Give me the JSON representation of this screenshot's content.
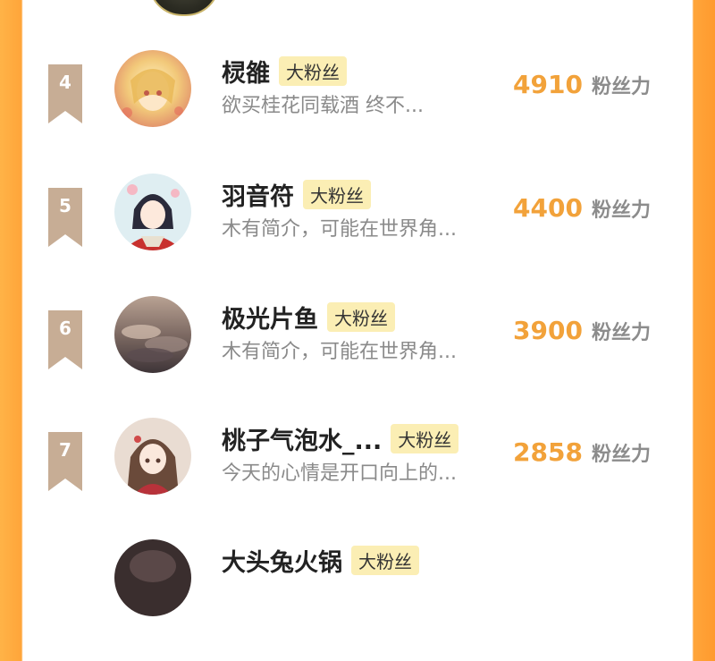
{
  "rows": [
    {
      "rank": "4",
      "name": "棂雒",
      "badge": "大粉丝",
      "bio": "欲买桂花同载酒 终不...",
      "count": "4910",
      "unit": "粉丝力"
    },
    {
      "rank": "5",
      "name": "羽音符",
      "badge": "大粉丝",
      "bio": "木有简介，可能在世界角...",
      "count": "4400",
      "unit": "粉丝力"
    },
    {
      "rank": "6",
      "name": "极光片鱼",
      "badge": "大粉丝",
      "bio": "木有简介，可能在世界角...",
      "count": "3900",
      "unit": "粉丝力"
    },
    {
      "rank": "7",
      "name": "桃子气泡水_...",
      "badge": "大粉丝",
      "bio": "今天的心情是开口向上的...",
      "count": "2858",
      "unit": "粉丝力"
    },
    {
      "rank": "",
      "name": "大头兔火锅",
      "badge": "大粉丝",
      "bio": "",
      "count": "",
      "unit": ""
    }
  ],
  "colors": {
    "accent_orange": "#f2a23a",
    "badge_bg": "#fbeeb4",
    "rank_flag": "#c7ad95",
    "frame_orange": "#ffa53a"
  }
}
